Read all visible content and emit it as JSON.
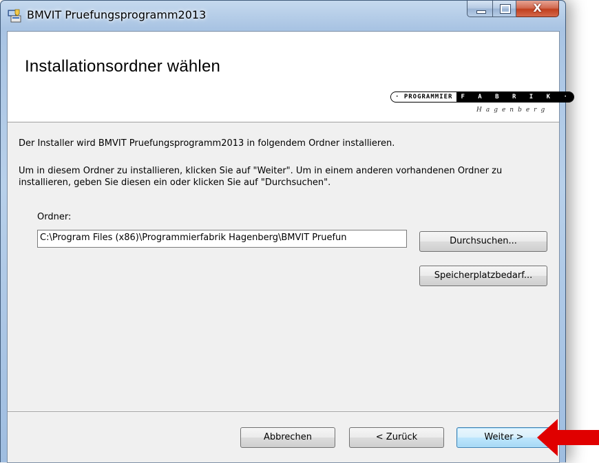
{
  "window": {
    "title": "BMVIT Pruefungsprogramm2013",
    "controls": {
      "close_glyph": "X"
    }
  },
  "banner": {
    "title": "Installationsordner wählen",
    "logo": {
      "top_left": "· PROGRAMMIER",
      "top_right": "F A B R I K ·",
      "subtitle": "Hagenberg"
    }
  },
  "content": {
    "intro": "Der Installer wird BMVIT Pruefungsprogramm2013 in folgendem Ordner installieren.",
    "instructions": "Um in diesem Ordner zu installieren, klicken Sie auf \"Weiter\". Um in einem anderen vorhandenen Ordner zu installieren, geben Sie diesen ein oder klicken Sie auf \"Durchsuchen\".",
    "folder_label": "Ordner:",
    "folder_value": "C:\\Program Files (x86)\\Programmierfabrik Hagenberg\\BMVIT Pruefun",
    "browse_button": "Durchsuchen...",
    "disk_space_button": "Speicherplatzbedarf..."
  },
  "footer": {
    "cancel_button": "Abbrechen",
    "back_button": "< Zurück",
    "next_button": "Weiter >"
  },
  "colors": {
    "annotation_arrow": "#e00000",
    "default_button_border": "#3c7fb1"
  }
}
